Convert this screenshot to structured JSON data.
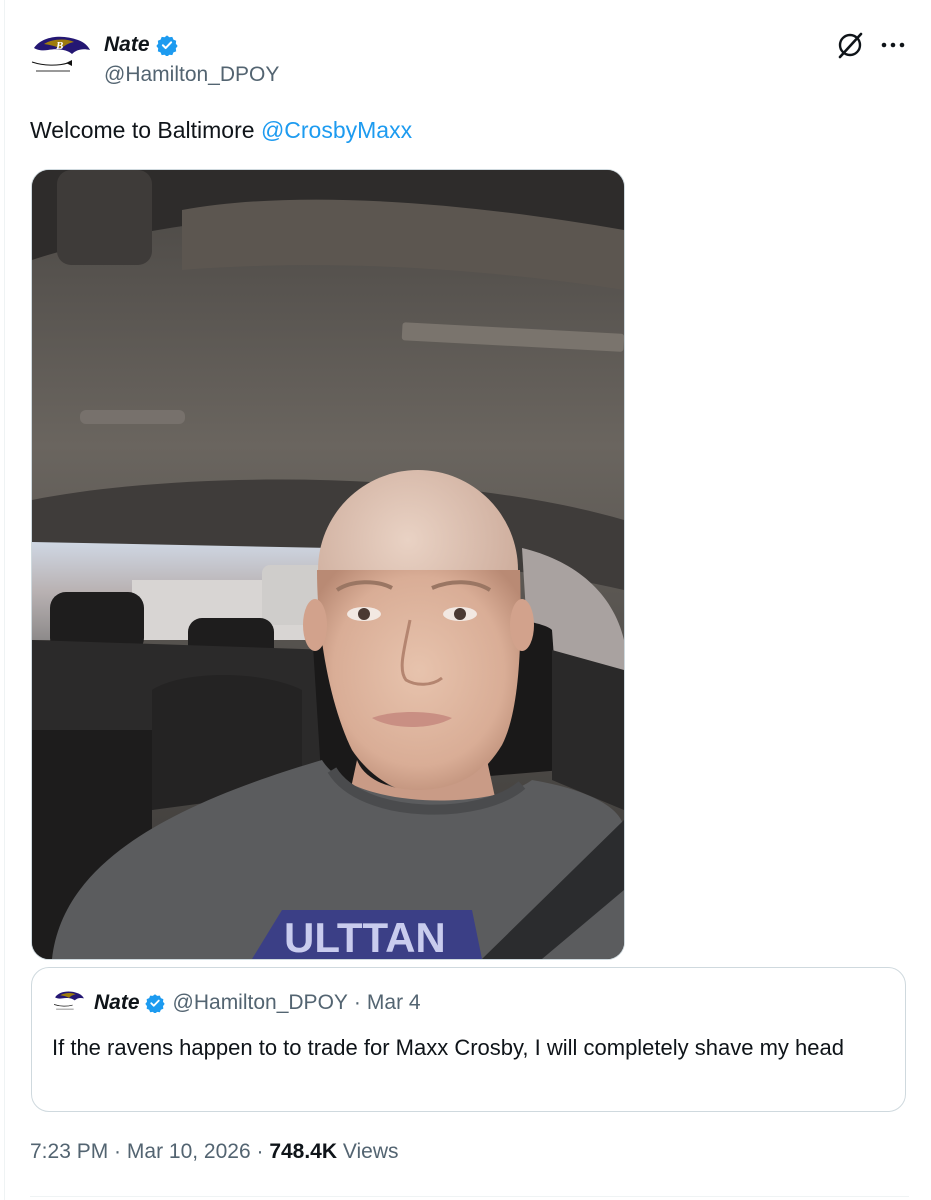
{
  "author": {
    "name": "Nate",
    "handle": "@Hamilton_DPOY"
  },
  "tweet": {
    "text_prefix": "Welcome to Baltimore ",
    "mention": "@CrosbyMaxx"
  },
  "photo": {
    "shirt_text": "ULTTAN"
  },
  "quoted_tweet": {
    "name": "Nate",
    "handle": "@Hamilton_DPOY",
    "separator": "·",
    "date": "Mar 4",
    "text": "If the ravens happen to to trade for Maxx Crosby, I will completely shave my head"
  },
  "footer": {
    "time": "7:23 PM",
    "separator": " · ",
    "date": "Mar 10, 2026",
    "views_count": "748.4K",
    "views_label": " Views"
  },
  "colors": {
    "link": "#1d9bf0",
    "verified": "#1d9bf0",
    "secondary_text": "#536471",
    "primary_text": "#0f1419",
    "border": "#cfd9de"
  },
  "icons": {
    "verified": "verified-badge-icon",
    "grok": "grok-icon",
    "more": "more-horizontal-icon",
    "avatar": "ravens-logo-icon"
  }
}
